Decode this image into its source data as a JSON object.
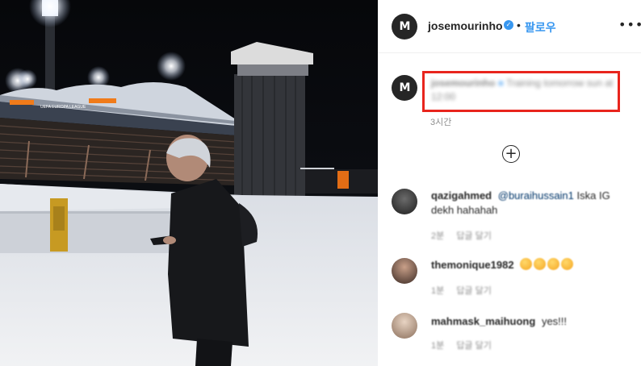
{
  "post": {
    "author": "josemourinho",
    "avatar_letter": "M",
    "separator": "•",
    "follow_label": "팔로우",
    "more_icon": "more-horizontal-icon",
    "verified_icon": "verified-badge-icon"
  },
  "caption": {
    "username": "josemourinho",
    "text": "Training tomorrow sun at 12:00",
    "time": "3시간"
  },
  "stadium": {
    "banner_text": "UEFA EUROPA LEAGUE"
  },
  "load_more_icon": "plus-circle-icon",
  "comments": [
    {
      "username": "qazigahmed",
      "mention": "@buraihussain1",
      "text": "Iska IG dekh hahahah",
      "time": "2분",
      "likes": "답글 달기"
    },
    {
      "username": "themonique1982",
      "text": "",
      "emoji_count": 4,
      "time": "1분",
      "likes": "답글 달기"
    },
    {
      "username": "mahmask_maihuong",
      "text": "yes!!!",
      "time": "1분",
      "likes": "답글 달기"
    }
  ],
  "colors": {
    "accent": "#3897f0",
    "highlight_box": "#e8251d",
    "text": "#262626",
    "muted": "#8e8e8e"
  }
}
